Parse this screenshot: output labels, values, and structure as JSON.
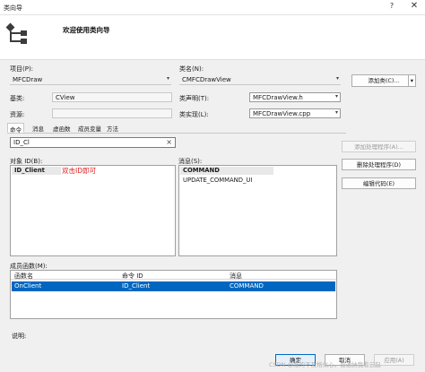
{
  "window": {
    "title": "类向导",
    "help_glyph": "?",
    "close_glyph": "✕"
  },
  "header": {
    "welcome": "欢迎使用类向导"
  },
  "project": {
    "label": "项目(P):",
    "value": "MFCDraw"
  },
  "class_name": {
    "label": "类名(N):",
    "value": "CMFCDrawView"
  },
  "add_class_button": {
    "label": "添加类(C)...",
    "arrow": "▾"
  },
  "base_class": {
    "label": "基类:",
    "value": "CView"
  },
  "class_declaration": {
    "label": "类声明(T):",
    "value": "MFCDrawView.h"
  },
  "resource": {
    "label": "资源:"
  },
  "class_impl": {
    "label": "类实现(L):",
    "value": "MFCDrawView.cpp"
  },
  "tabs": [
    {
      "label": "命令"
    },
    {
      "label": "消息"
    },
    {
      "label": "虚函数"
    },
    {
      "label": "成员变量"
    },
    {
      "label": "方法"
    }
  ],
  "search": {
    "value": "ID_Cl",
    "clear_glyph": "×"
  },
  "object_ids": {
    "label": "对象 ID(B):",
    "items": [
      "ID_Client"
    ]
  },
  "annotation": "双击ID即可",
  "messages": {
    "label": "消息(S):",
    "items": [
      "COMMAND",
      "UPDATE_COMMAND_UI"
    ]
  },
  "side_buttons": {
    "add_handler": "添加处理程序(A)...",
    "delete_handler": "删除处理程序(D)",
    "edit_code": "编辑代码(E)"
  },
  "member_functions": {
    "label": "成员函数(M):",
    "columns": [
      "函数名",
      "命令 ID",
      "消息"
    ],
    "rows": [
      [
        "OnClient",
        "ID_Client",
        "COMMAND"
      ]
    ]
  },
  "description": {
    "label": "说明:"
  },
  "footer": {
    "ok": "确定",
    "cancel": "取消",
    "apply": "应用(A)"
  },
  "watermark": "CSDN @敲的不及格似心，普通扶我看云起",
  "colors": {
    "selection": "#0067c0",
    "annotation": "#e02020"
  }
}
